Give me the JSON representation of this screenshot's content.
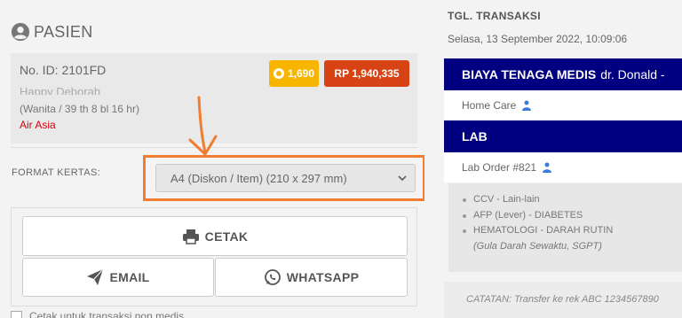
{
  "patient": {
    "section_title": "PASIEN",
    "id_text": "No. ID: 2101FD",
    "name_partial": "Happy Deborah",
    "demographics": "(Wanita / 39 th 8 bl 16 hr)",
    "payer": "Air Asia",
    "points": "1,690",
    "balance": "RP 1,940,335"
  },
  "format": {
    "label": "FORMAT KERTAS:",
    "selected": "A4 (Diskon / Item) (210 x 297 mm)"
  },
  "actions": {
    "print_label": "CETAK",
    "email_label": "EMAIL",
    "whatsapp_label": "WHATSAPP"
  },
  "bottom_checkbox_label": "Cetak untuk transaksi non medis",
  "transaction": {
    "date_label": "TGL. TRANSAKSI",
    "date_value": "Selasa, 13 September 2022, 10:09:06"
  },
  "sections": {
    "medical_fee_title": "BIAYA TENAGA MEDIS",
    "medical_fee_doctor": "dr. Donald -",
    "home_care": "Home Care",
    "lab_title": "LAB",
    "lab_order": "Lab Order #821",
    "lab_items": [
      "CCV - Lain-lain",
      "AFP (Lever) - DIABETES",
      "HEMATOLOGI - DARAH RUTIN"
    ],
    "lab_item_note": "(Gula Darah Sewaktu, SGPT)",
    "note": "CATATAN: Transfer ke rek ABC 1234567890"
  },
  "colors": {
    "navy": "#000080",
    "orange_highlight": "#f07d32",
    "points_badge": "#f7b500",
    "balance_badge": "#d84315",
    "payer_text": "#d8000c"
  }
}
